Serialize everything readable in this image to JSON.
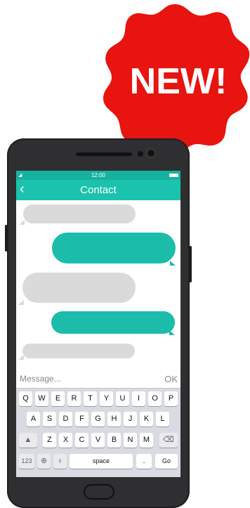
{
  "badge": {
    "text": "NEW!",
    "color": "#e8140f"
  },
  "status": {
    "time": "12:00"
  },
  "header": {
    "title": "Contact",
    "back_icon": "chevron-left-icon"
  },
  "composer": {
    "placeholder": "Message...",
    "send_label": "OK"
  },
  "keyboard": {
    "row1": [
      "Q",
      "W",
      "E",
      "R",
      "T",
      "Y",
      "U",
      "I",
      "O",
      "P"
    ],
    "row2": [
      "A",
      "S",
      "D",
      "F",
      "G",
      "H",
      "J",
      "K",
      "L"
    ],
    "row3": [
      "Z",
      "X",
      "C",
      "V",
      "B",
      "N",
      "M"
    ],
    "bottom": {
      "numbers": "123",
      "space": "space",
      "period": ".",
      "go": "Go"
    }
  },
  "colors": {
    "accent": "#1bc2ad",
    "bubble_gray": "#dadada",
    "bubble_teal": "#1bbca9"
  }
}
